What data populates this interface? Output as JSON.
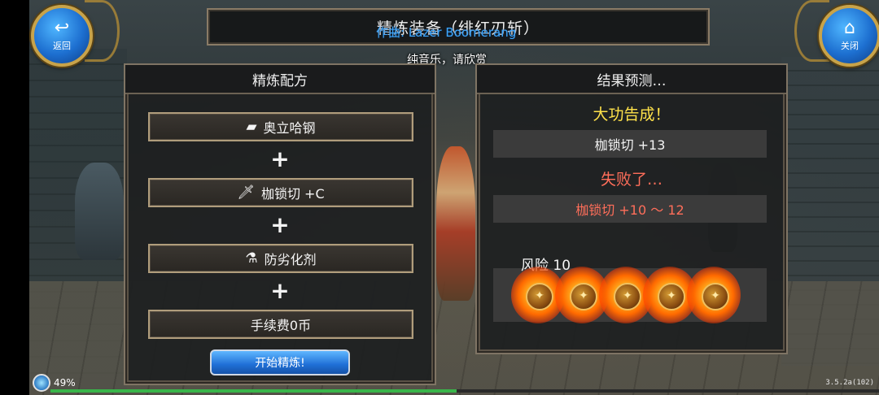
{
  "header": {
    "title": "精炼装备（绯红刃斩）",
    "back_label": "返回",
    "close_label": "关闭"
  },
  "overlay": {
    "song": "作曲: Lazer Boomerang",
    "subtitle": "纯音乐，请欣赏"
  },
  "recipe": {
    "title": "精炼配方",
    "items": [
      {
        "label": "奥立哈钢",
        "icon": "ore-icon"
      },
      {
        "label": "枷锁切 +C",
        "icon": "sword-icon"
      },
      {
        "label": "防劣化剂",
        "icon": "potion-icon"
      }
    ],
    "fee": "手续费0币",
    "plus": "+",
    "start_label": "开始精炼!"
  },
  "result": {
    "title": "结果预测…",
    "success_title": "大功告成！",
    "success_item": "枷锁切  +13",
    "fail_title": "失败了…",
    "fail_item": "枷锁切  +10  ～  12",
    "risk_label": "风险  10",
    "risk_flames": 5
  },
  "status": {
    "battery": "49%",
    "progress": 0.49,
    "version": "3.5.2a(102)"
  },
  "colors": {
    "success": "#ffe24a",
    "fail": "#ff6e5a",
    "accent_blue": "#1f6fd6",
    "frame_gold": "#c8a34a"
  }
}
